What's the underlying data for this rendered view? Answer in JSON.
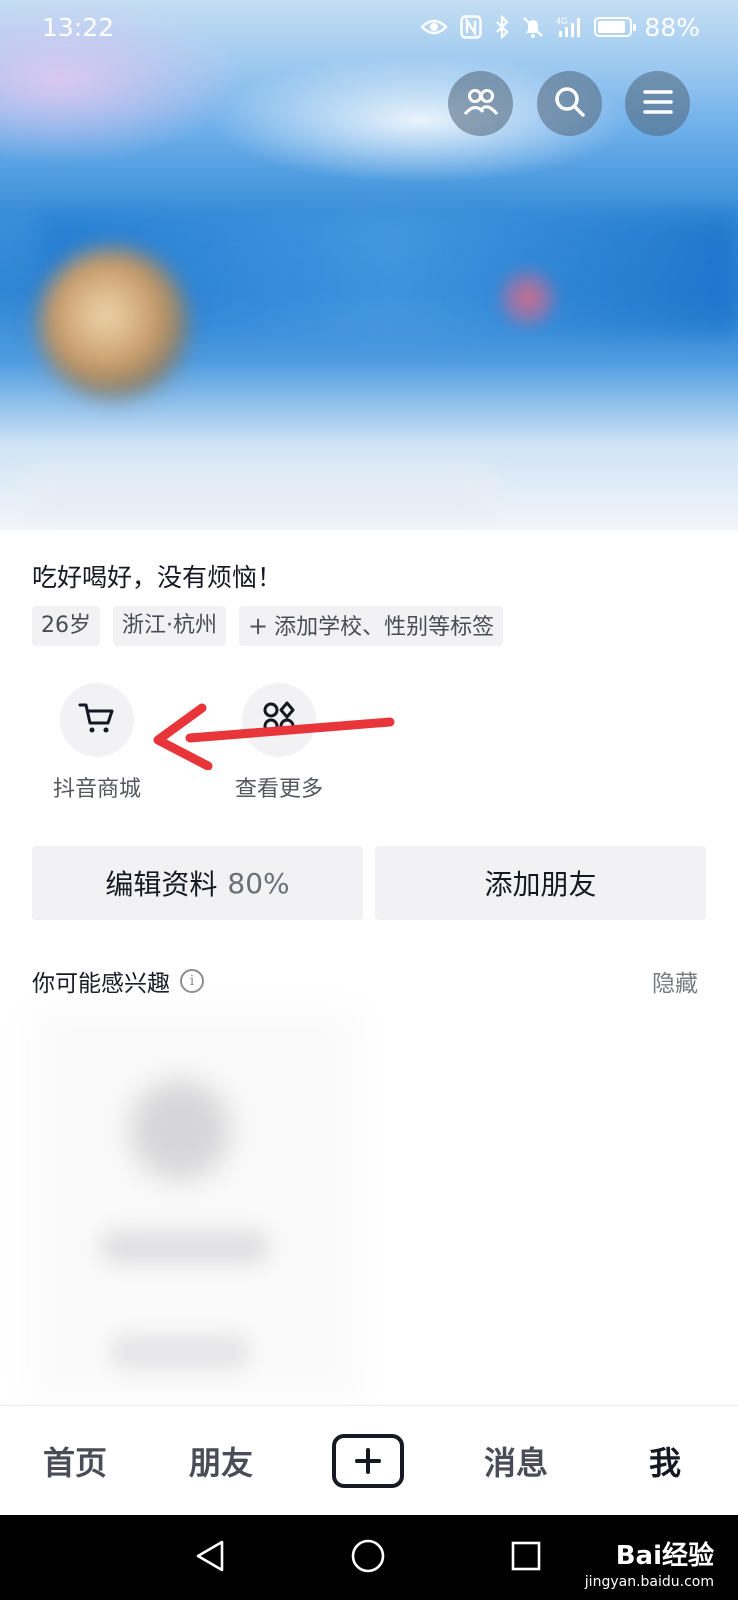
{
  "status_bar": {
    "time": "13:22",
    "battery": "88%",
    "battery_level": 0.88,
    "signal": "4G"
  },
  "header": {
    "buttons": [
      {
        "name": "friends-button",
        "icon": "friends-icon"
      },
      {
        "name": "search-button",
        "icon": "search-icon"
      },
      {
        "name": "menu-button",
        "icon": "menu-icon"
      }
    ]
  },
  "profile": {
    "bio": "吃好喝好，没有烦恼！",
    "tags": [
      "26岁",
      "浙江·杭州",
      "添加学校、性别等标签"
    ],
    "add_tag_icon": "plus-icon"
  },
  "shortcuts": [
    {
      "label": "抖音商城",
      "icon": "cart-icon"
    },
    {
      "label": "查看更多",
      "icon": "more-apps-icon"
    }
  ],
  "actions": {
    "edit_profile": "编辑资料",
    "edit_progress": "80%",
    "add_friend": "添加朋友"
  },
  "interest": {
    "title": "你可能感兴趣",
    "info_icon": "i",
    "hide": "隐藏"
  },
  "bottom_nav": {
    "items": [
      "首页",
      "朋友",
      "消息",
      "我"
    ],
    "active": "我",
    "create_icon": "plus-box-icon"
  },
  "system_nav": [
    "back-icon",
    "home-icon",
    "recents-icon"
  ],
  "watermark": {
    "brand": "Bai经验",
    "url": "jingyan.baidu.com"
  },
  "colors": {
    "annotation_arrow": "#e8353a",
    "banner_blue": "#2f86d4"
  }
}
